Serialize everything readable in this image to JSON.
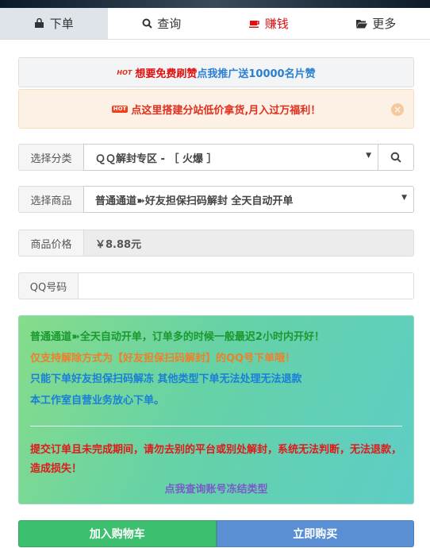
{
  "nav": {
    "tabs": [
      {
        "label": "下单",
        "icon": "shopping-bag-icon"
      },
      {
        "label": "查询",
        "icon": "search-icon"
      },
      {
        "label": "赚钱",
        "icon": "coffee-cup-icon"
      },
      {
        "label": "更多",
        "icon": "folder-open-icon"
      }
    ]
  },
  "notice1": {
    "badge": "HOT",
    "text_red": "想要免费刷赞",
    "text_blue": "点我推广送10000名片赞"
  },
  "notice2": {
    "badge": "HOT",
    "text": "点这里搭建分站低价拿货,月入过万福利！",
    "close": "×"
  },
  "form": {
    "category_label": "选择分类",
    "category_value": "ＱＱ解封专区 - ［ 火爆 ］",
    "product_label": "选择商品",
    "product_value": "普通通道➽好友担保扫码解封 全天自动开单",
    "price_label": "商品价格",
    "price_value": "￥8.88元",
    "qq_label": "QQ号码",
    "qq_placeholder": ""
  },
  "info": {
    "line1": "普通通道➽全天自动开单，订单多的时候一般最迟2小时内开好！",
    "line2": "仅支持解除方式为【好友担保扫码解封】的QQ号下单哦！",
    "line3": "只能下单好友担保扫码解冻 其他类型下单无法处理无法退款",
    "line4": "本工作室自营业务放心下单。",
    "warning": "提交订单且未完成期间，请勿去别的平台或别处解封，系统无法判断，无法退款，造成损失！",
    "link": "点我查询账号冻结类型"
  },
  "buttons": {
    "add_cart": "加入购物车",
    "buy_now": "立即购买"
  },
  "colors": {
    "red": "#e01010",
    "green_btn": "#3cbf6f",
    "blue_btn": "#5b8fd4"
  }
}
